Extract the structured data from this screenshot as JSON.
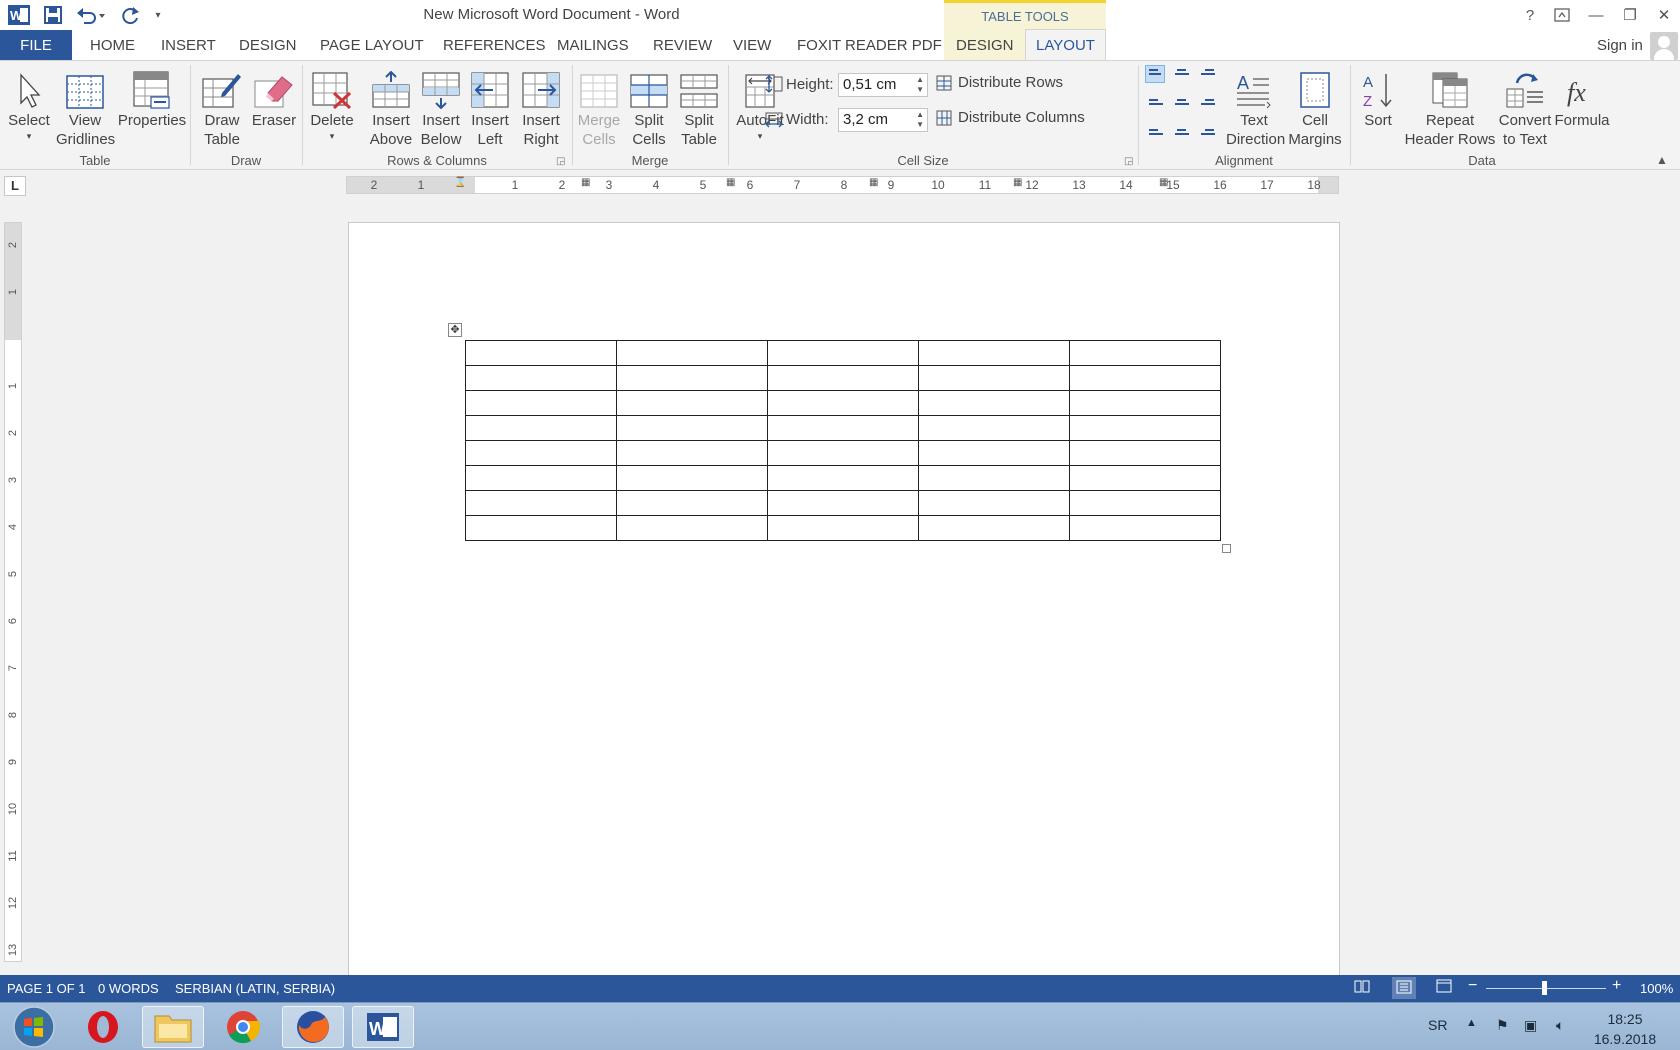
{
  "window": {
    "title": "New Microsoft Word Document - Word",
    "table_tools_label": "TABLE TOOLS",
    "help_glyph": "?",
    "minimize_glyph": "—",
    "restore_glyph": "❐",
    "close_glyph": "✕"
  },
  "tabs": {
    "file": "FILE",
    "items": [
      "HOME",
      "INSERT",
      "DESIGN",
      "PAGE LAYOUT",
      "REFERENCES",
      "MAILINGS",
      "REVIEW",
      "VIEW",
      "FOXIT READER PDF",
      "DESIGN",
      "LAYOUT"
    ],
    "active": "LAYOUT",
    "sign_in": "Sign in"
  },
  "ribbon": {
    "table": {
      "label": "Table",
      "select": "Select",
      "view_gridlines": [
        "View",
        "Gridlines"
      ],
      "properties": "Properties"
    },
    "draw": {
      "label": "Draw",
      "draw_table": [
        "Draw",
        "Table"
      ],
      "eraser": "Eraser"
    },
    "rows_columns": {
      "label": "Rows & Columns",
      "delete": "Delete",
      "insert_above": [
        "Insert",
        "Above"
      ],
      "insert_below": [
        "Insert",
        "Below"
      ],
      "insert_left": [
        "Insert",
        "Left"
      ],
      "insert_right": [
        "Insert",
        "Right"
      ]
    },
    "merge": {
      "label": "Merge",
      "merge_cells": [
        "Merge",
        "Cells"
      ],
      "split_cells": [
        "Split",
        "Cells"
      ],
      "split_table": [
        "Split",
        "Table"
      ]
    },
    "cell_size": {
      "label": "Cell Size",
      "autofit": "AutoFit",
      "height_label": "Height:",
      "height_value": "0,51 cm",
      "width_label": "Width:",
      "width_value": "3,2 cm",
      "distribute_rows": "Distribute Rows",
      "distribute_columns": "Distribute Columns"
    },
    "alignment": {
      "label": "Alignment",
      "text_direction": [
        "Text",
        "Direction"
      ],
      "cell_margins": [
        "Cell",
        "Margins"
      ]
    },
    "data": {
      "label": "Data",
      "sort": "Sort",
      "repeat_header_rows": [
        "Repeat",
        "Header Rows"
      ],
      "convert_to_text": [
        "Convert",
        "to Text"
      ],
      "formula": "Formula"
    }
  },
  "ruler": {
    "horizontal_left": [
      "2",
      "1"
    ],
    "horizontal_right": [
      "1",
      "2",
      "3",
      "4",
      "5",
      "6",
      "7",
      "8",
      "9",
      "10",
      "11",
      "12",
      "13",
      "14",
      "15",
      "16",
      "17",
      "18"
    ],
    "vertical_top": [
      "2",
      "1"
    ],
    "vertical_body": [
      "1",
      "2",
      "3",
      "4",
      "5",
      "6",
      "7",
      "8",
      "9",
      "10",
      "11",
      "12",
      "13"
    ],
    "tab_selector": "L"
  },
  "document": {
    "table": {
      "rows": 8,
      "cols": 5
    }
  },
  "status": {
    "page": "PAGE 1 OF 1",
    "words": "0 WORDS",
    "language": "SERBIAN (LATIN, SERBIA)",
    "zoom": "100%",
    "zoom_level": 1.0
  },
  "taskbar": {
    "apps": [
      "Start",
      "Opera",
      "File Explorer",
      "Chrome",
      "Firefox",
      "Word"
    ],
    "active_app": "Word",
    "lang": "SR",
    "time": "18:25",
    "date": "16.9.2018"
  },
  "colors": {
    "accent": "#2b579a",
    "table_tools_band": "#f7f3d6",
    "table_tools_border": "#f2d22e"
  }
}
